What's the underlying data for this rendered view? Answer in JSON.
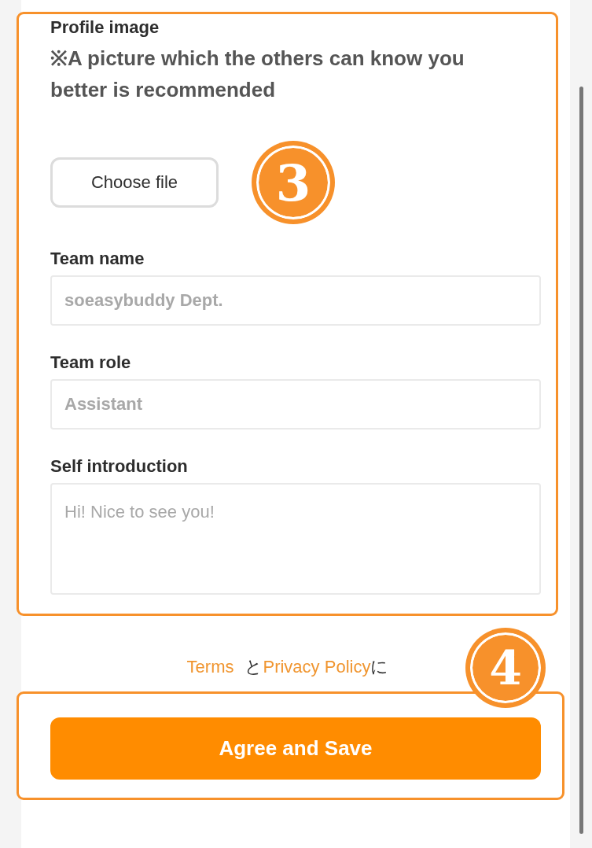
{
  "profile_image": {
    "label": "Profile image",
    "note": "※A picture which the others can know you better is recommended",
    "button": "Choose file",
    "step_badge": "3"
  },
  "fields": [
    {
      "label": "Team name",
      "placeholder": "soeasybuddy Dept.",
      "kind": "input"
    },
    {
      "label": "Team role",
      "placeholder": "Assistant",
      "kind": "input"
    },
    {
      "label": "Self introduction",
      "placeholder": "Hi! Nice to see you!",
      "kind": "textarea"
    }
  ],
  "consent": {
    "terms_link": "Terms",
    "joiner": "と",
    "privacy_link": "Privacy Policy",
    "suffix": "に",
    "step_badge": "4"
  },
  "submit_button": "Agree and Save"
}
